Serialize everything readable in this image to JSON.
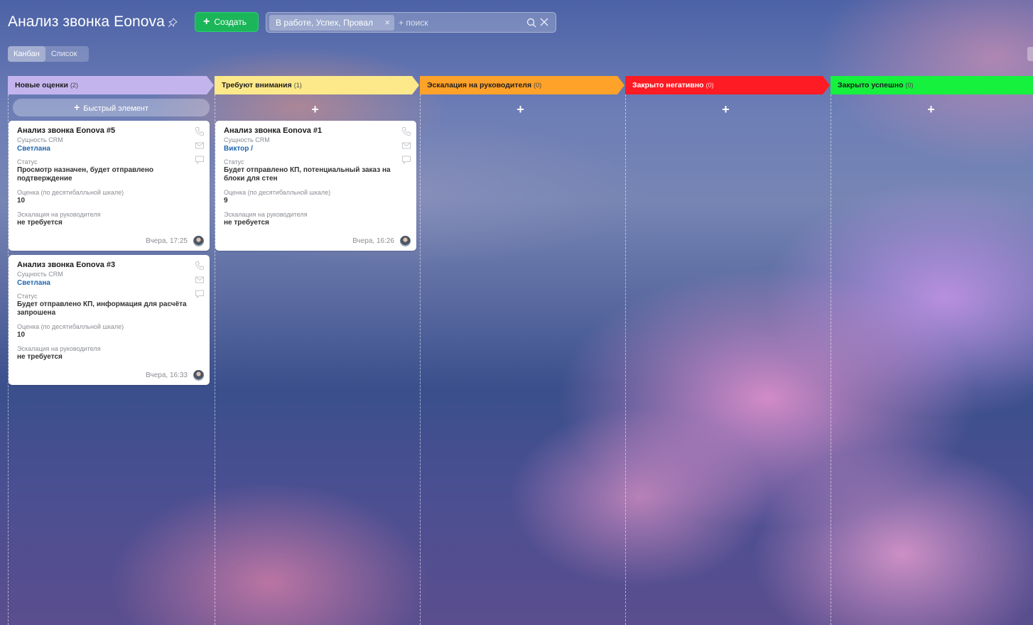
{
  "header": {
    "title": "Анализ звонка Eonova",
    "create_label": "Создать",
    "filter_chip": "В работе, Успех, Провал",
    "search_placeholder": "+ поиск"
  },
  "view_tabs": [
    "Канбан",
    "Список"
  ],
  "columns": [
    {
      "title": "Новые оценки",
      "count": "(2)",
      "color": "#c4b4ee"
    },
    {
      "title": "Требуют внимания",
      "count": "(1)",
      "color": "#fde98a"
    },
    {
      "title": "Эскалация на руководителя",
      "count": "(0)",
      "color": "#ffa22a"
    },
    {
      "title": "Закрыто негативно",
      "count": "(0)",
      "color": "#ff1b24"
    },
    {
      "title": "Закрыто успешно",
      "count": "(0)",
      "color": "#16f13e"
    }
  ],
  "quick_add_label": "Быстрый элемент",
  "card_labels": {
    "entity": "Сущность CRM",
    "status": "Статус",
    "score": "Оценка (по десятибалльной шкале)",
    "escalation": "Эскалация на руководителя"
  },
  "cards": [
    {
      "title": "Анализ звонка Eonova #5",
      "contact": "Светлана",
      "status": "Просмотр назначен, будет отправлено подтверждение",
      "score": "10",
      "escalation": "не требуется",
      "time": "Вчера, 17:25"
    },
    {
      "title": "Анализ звонка Eonova #3",
      "contact": "Светлана",
      "status": "Будет отправлено КП, информация для расчёта запрошена",
      "score": "10",
      "escalation": "не требуется",
      "time": "Вчера, 16:33"
    },
    {
      "title": "Анализ звонка Eonova #1",
      "contact": "Виктор /",
      "status": "Будет отправлено КП, потенциальный заказ на блоки для стен",
      "score": "9",
      "escalation": "не требуется",
      "time": "Вчера, 16:26"
    }
  ],
  "colors": {
    "create_button": "#1cb65a",
    "link": "#2067b0"
  }
}
